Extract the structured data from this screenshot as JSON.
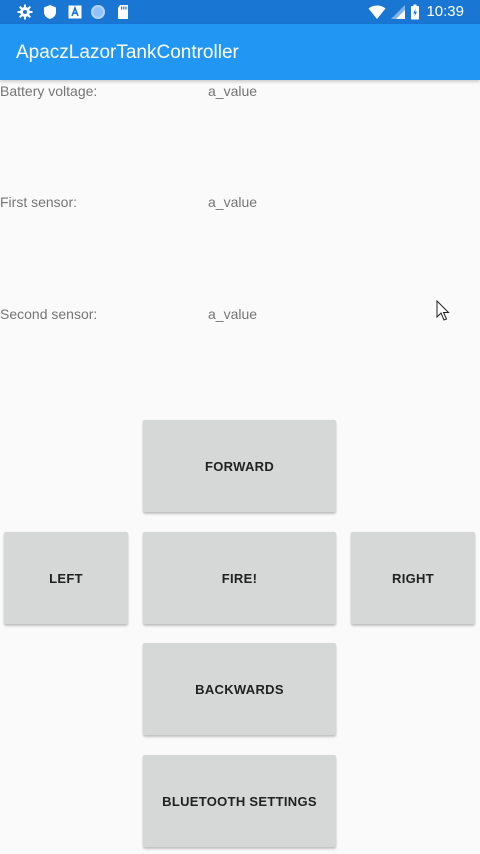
{
  "status_bar": {
    "time": "10:39",
    "left_icons": [
      "settings-icon",
      "shield-icon",
      "font-icon",
      "circle-icon",
      "sd-card-icon"
    ],
    "right_icons": [
      "wifi-icon",
      "signal-icon",
      "battery-icon"
    ],
    "background": "#1976d2"
  },
  "app_bar": {
    "title": "ApaczLazorTankController",
    "background": "#2196f3"
  },
  "readouts": [
    {
      "label": "Battery voltage:",
      "value": "a_value"
    },
    {
      "label": "First sensor:",
      "value": "a_value"
    },
    {
      "label": "Second sensor:",
      "value": "a_value"
    }
  ],
  "controls": {
    "forward": "FORWARD",
    "left": "LEFT",
    "fire": "FIRE!",
    "right": "RIGHT",
    "backwards": "BACKWARDS",
    "bluetooth_settings": "BLUETOOTH SETTINGS"
  }
}
